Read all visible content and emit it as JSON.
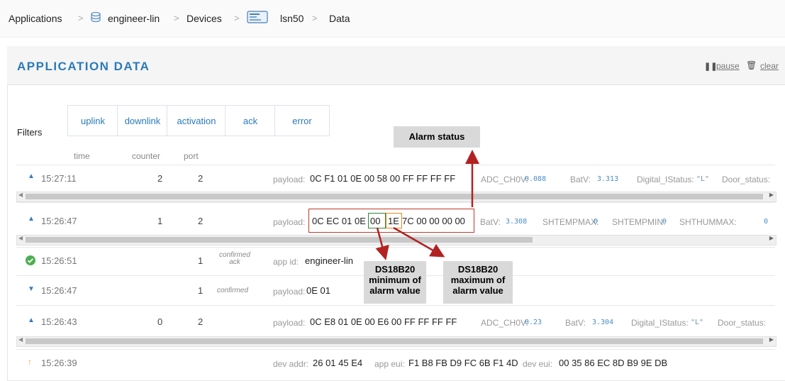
{
  "breadcrumb": {
    "items": [
      "Applications",
      "engineer-lin",
      "Devices",
      "lsn50",
      "Data"
    ],
    "separator": ">"
  },
  "panel": {
    "title": "APPLICATION DATA",
    "pause_label": "pause",
    "clear_label": "clear"
  },
  "filters": {
    "label": "Filters",
    "buttons": [
      "uplink",
      "downlink",
      "activation",
      "ack",
      "error"
    ]
  },
  "columns": [
    "time",
    "counter",
    "port"
  ],
  "rows": [
    {
      "icon": "uplink-icon",
      "time": "15:27:11",
      "counter": "2",
      "port": "2",
      "payload_label": "payload:",
      "payload": "0C F1 01 0E 00 58 00 FF FF FF FF",
      "fields": [
        {
          "key": "ADC_CH0V:",
          "val": "0.088"
        },
        {
          "key": "BatV:",
          "val": "3.313"
        },
        {
          "key": "Digital_IStatus:",
          "val": "\"L\""
        },
        {
          "key": "Door_status:",
          "val": ""
        }
      ]
    },
    {
      "icon": "uplink-icon",
      "time": "15:26:47",
      "counter": "1",
      "port": "2",
      "payload_label": "payload:",
      "payload_a": "0C EC 01 0E",
      "payload_b": "00",
      "payload_c": "1E",
      "payload_d": "7C 00 00 00 00",
      "fields": [
        {
          "key": "BatV:",
          "val": "3.308"
        },
        {
          "key": "SHTEMPMAX:",
          "val": "0"
        },
        {
          "key": "SHTEMPMIN:",
          "val": "0"
        },
        {
          "key": "SHTHUMMAX:",
          "val": "0"
        }
      ]
    },
    {
      "icon": "ack-icon",
      "time": "15:26:51",
      "counter": "1",
      "tag_line1": "confirmed",
      "tag_line2": "ack",
      "app_id_label": "app id:",
      "app_id": "engineer-lin"
    },
    {
      "icon": "downlink-icon",
      "time": "15:26:47",
      "counter": "1",
      "tag": "confirmed",
      "payload_label": "payload:",
      "payload": "0E 01"
    },
    {
      "icon": "uplink-icon",
      "time": "15:26:43",
      "counter": "0",
      "port": "2",
      "payload_label": "payload:",
      "payload": "0C E8 01 0E 00 E6 00 FF FF FF FF",
      "fields": [
        {
          "key": "ADC_CH0V:",
          "val": "0.23"
        },
        {
          "key": "BatV:",
          "val": "3.304"
        },
        {
          "key": "Digital_IStatus:",
          "val": "\"L\""
        },
        {
          "key": "Door_status:",
          "val": ""
        }
      ]
    },
    {
      "icon": "activation-icon",
      "time": "15:26:39",
      "dev_addr_label": "dev addr:",
      "dev_addr": "26 01 45 E4",
      "app_eui_label": "app eui:",
      "app_eui": "F1 B8 FB D9 FC 6B F1 4D",
      "dev_eui_label": "dev eui:",
      "dev_eui": "00 35 86 EC 8D B9 9E DB"
    }
  ],
  "annotations": {
    "alarm_status": "Alarm status",
    "min_line1": "DS18B20",
    "min_line2": "minimum of",
    "min_line3": "alarm value",
    "max_line1": "DS18B20",
    "max_line2": "maximum of",
    "max_line3": "alarm value"
  },
  "colors": {
    "accent": "#2a7ab8",
    "arrow_red": "#b22222",
    "frame_green": "#2e8b3a",
    "frame_orange": "#e08b1e",
    "ack_green": "#4caf50",
    "activation_orange": "#f0a030"
  }
}
